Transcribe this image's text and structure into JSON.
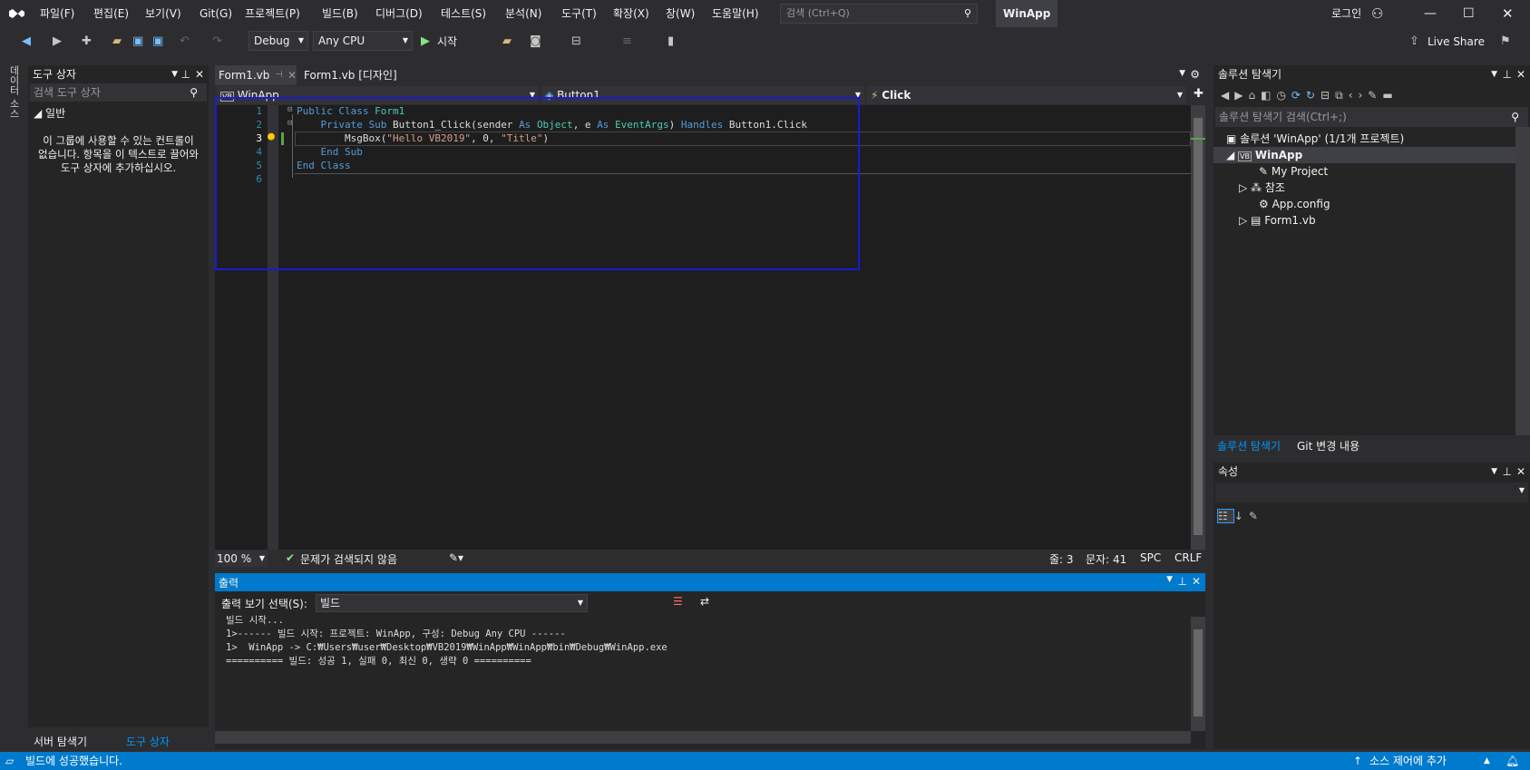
{
  "menu": [
    "파일(F)",
    "편집(E)",
    "보기(V)",
    "Git(G)",
    "프로젝트(P)",
    "빌드(B)",
    "디버그(D)",
    "테스트(S)",
    "분석(N)",
    "도구(T)",
    "확장(X)",
    "창(W)",
    "도움말(H)"
  ],
  "search": {
    "placeholder": "검색 (Ctrl+Q)"
  },
  "app_title": "WinApp",
  "login": "로그인",
  "toolbar": {
    "config": "Debug",
    "platform": "Any CPU",
    "start": "시작",
    "live_share": "Live Share"
  },
  "left_strip": "데이터 소스",
  "toolbox": {
    "title": "도구 상자",
    "search_placeholder": "검색 도구 상자",
    "group": "일반",
    "empty_msg": "이 그룹에 사용할 수 있는 컨트롤이 없습니다. 항목을 이 텍스트로 끌어와 도구 상자에 추가하십시오.",
    "tab_server": "서버 탐색기",
    "tab_toolbox": "도구 상자"
  },
  "editor": {
    "tabs": [
      {
        "label": "Form1.vb"
      },
      {
        "label": "Form1.vb [디자인]"
      }
    ],
    "nav": {
      "project": "WinApp",
      "object": "Button1",
      "event": "Click"
    },
    "lines": [
      "1",
      "2",
      "3",
      "4",
      "5",
      "6"
    ],
    "zoom": "100 %",
    "issues": "문제가 검색되지 않음",
    "line": "줄: 3",
    "col": "문자: 41",
    "spc": "SPC",
    "crlf": "CRLF"
  },
  "output": {
    "title": "출력",
    "show_label": "출력 보기 선택(S):",
    "show_value": "빌드",
    "lines": [
      "빌드 시작...",
      "1>------ 빌드 시작: 프로젝트: WinApp, 구성: Debug Any CPU ------",
      "1>  WinApp -> C:₩Users₩user₩Desktop₩VB2019₩WinApp₩WinApp₩bin₩Debug₩WinApp.exe",
      "========== 빌드: 성공 1, 실패 0, 최신 0, 생략 0 =========="
    ]
  },
  "solution": {
    "title": "솔루션 탐색기",
    "search_placeholder": "솔루션 탐색기 검색(Ctrl+;)",
    "root": "솔루션 'WinApp' (1/1개 프로젝트)",
    "project": "WinApp",
    "items": [
      "My Project",
      "참조",
      "App.config",
      "Form1.vb"
    ],
    "tab_solution": "솔루션 탐색기",
    "tab_git": "Git 변경 내용"
  },
  "properties": {
    "title": "속성"
  },
  "status": {
    "message": "빌드에 성공했습니다.",
    "source_control": "소스 제어에 추가"
  }
}
